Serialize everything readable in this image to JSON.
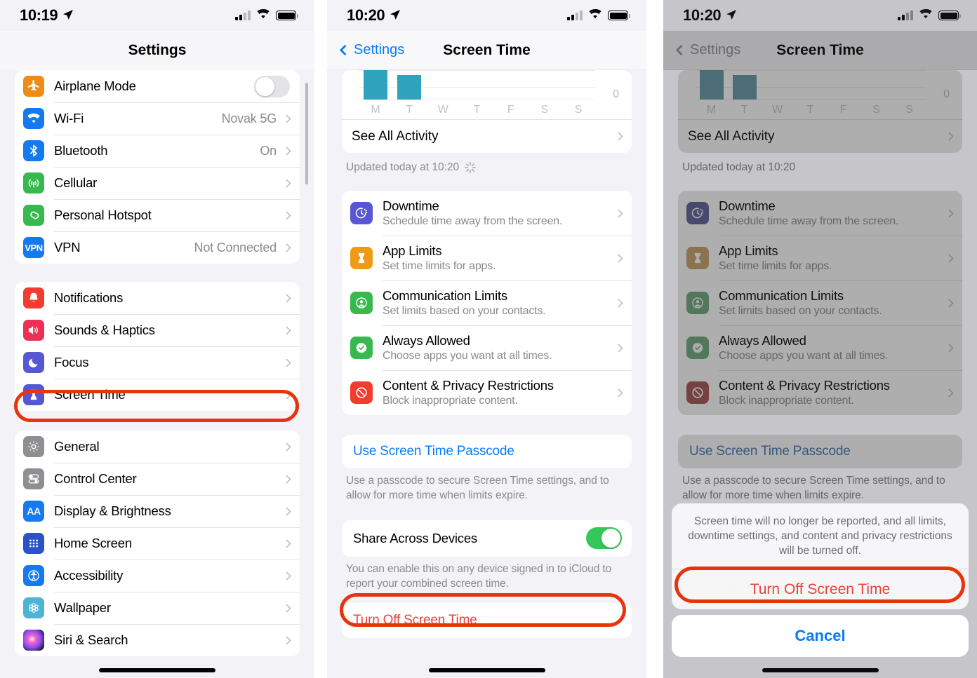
{
  "colors": {
    "annotation_red": "#e8340c",
    "ios_blue": "#067cfb",
    "destructive_red": "#e8443c",
    "toggle_green": "#34c759",
    "chart_bar_teal": "#2fa3bd",
    "group_bg": "#f2f2f7"
  },
  "panel1": {
    "status": {
      "time": "10:19",
      "location_icon": "location-arrow",
      "wifi_icon": "wifi",
      "battery_icon": "battery-full"
    },
    "nav_title": "Settings",
    "groups": [
      {
        "rows": [
          {
            "label": "Airplane Mode",
            "icon": "airplane-icon",
            "icon_color": "#ef8c14",
            "control": "toggle",
            "toggle_on": false
          },
          {
            "label": "Wi-Fi",
            "icon": "wifi-icon",
            "icon_color": "#1579ef",
            "value": "Novak 5G",
            "control": "chevron"
          },
          {
            "label": "Bluetooth",
            "icon": "bluetooth-icon",
            "icon_color": "#1579ef",
            "value": "On",
            "control": "chevron"
          },
          {
            "label": "Cellular",
            "icon": "cellular-icon",
            "icon_color": "#38b94e",
            "value": "",
            "control": "chevron"
          },
          {
            "label": "Personal Hotspot",
            "icon": "hotspot-icon",
            "icon_color": "#38b94e",
            "value": "",
            "control": "chevron"
          },
          {
            "label": "VPN",
            "icon": "vpn-icon",
            "icon_color": "#1579ef",
            "value": "Not Connected",
            "control": "chevron"
          }
        ]
      },
      {
        "rows": [
          {
            "label": "Notifications",
            "icon": "bell-icon",
            "icon_color": "#f33b30",
            "value": "",
            "control": "chevron"
          },
          {
            "label": "Sounds & Haptics",
            "icon": "speaker-icon",
            "icon_color": "#ee2f55",
            "value": "",
            "control": "chevron"
          },
          {
            "label": "Focus",
            "icon": "moon-icon",
            "icon_color": "#5757d6",
            "value": "",
            "control": "chevron"
          },
          {
            "label": "Screen Time",
            "icon": "hourglass-icon",
            "icon_color": "#5757d6",
            "value": "",
            "control": "chevron",
            "highlighted": true
          }
        ]
      },
      {
        "rows": [
          {
            "label": "General",
            "icon": "gear-icon",
            "icon_color": "#8e8e93",
            "value": "",
            "control": "chevron"
          },
          {
            "label": "Control Center",
            "icon": "control-center-icon",
            "icon_color": "#8e8e93",
            "value": "",
            "control": "chevron"
          },
          {
            "label": "Display & Brightness",
            "icon": "display-brightness-icon",
            "icon_color": "#1579ef",
            "value": "",
            "control": "chevron"
          },
          {
            "label": "Home Screen",
            "icon": "home-screen-icon",
            "icon_color": "#2b52c8",
            "value": "",
            "control": "chevron"
          },
          {
            "label": "Accessibility",
            "icon": "accessibility-icon",
            "icon_color": "#1579ef",
            "value": "",
            "control": "chevron"
          },
          {
            "label": "Wallpaper",
            "icon": "wallpaper-icon",
            "icon_color": "#4db5d4",
            "value": "",
            "control": "chevron"
          },
          {
            "label": "Siri & Search",
            "icon": "siri-icon",
            "icon_color": "#2a2a35",
            "value": "",
            "control": "chevron"
          }
        ]
      }
    ]
  },
  "panel2": {
    "status": {
      "time": "10:20"
    },
    "back_label": "Settings",
    "nav_title": "Screen Time",
    "see_all_activity": "See All Activity",
    "updated_text": "Updated today at 10:20",
    "has_spinner": true,
    "options": [
      {
        "title": "Downtime",
        "subtitle": "Schedule time away from the screen.",
        "icon": "downtime-icon",
        "icon_color": "#5757d6"
      },
      {
        "title": "App Limits",
        "subtitle": "Set time limits for apps.",
        "icon": "hourglass-icon",
        "icon_color": "#ef9a14"
      },
      {
        "title": "Communication Limits",
        "subtitle": "Set limits based on your contacts.",
        "icon": "person-circle-icon",
        "icon_color": "#38b94e"
      },
      {
        "title": "Always Allowed",
        "subtitle": "Choose apps you want at all times.",
        "icon": "check-badge-icon",
        "icon_color": "#38b94e"
      },
      {
        "title": "Content & Privacy Restrictions",
        "subtitle": "Block inappropriate content.",
        "icon": "no-entry-icon",
        "icon_color": "#f33b30"
      }
    ],
    "passcode_label": "Use Screen Time Passcode",
    "passcode_footnote": "Use a passcode to secure Screen Time settings, and to allow for more time when limits expire.",
    "share_label": "Share Across Devices",
    "share_toggle_on": true,
    "share_footnote": "You can enable this on any device signed in to iCloud to report your combined screen time.",
    "turn_off_label": "Turn Off Screen Time",
    "turn_off_highlighted": true
  },
  "panel3": {
    "status": {
      "time": "10:20"
    },
    "back_label": "Settings",
    "nav_title": "Screen Time",
    "see_all_activity": "See All Activity",
    "updated_text": "Updated today at 10:20",
    "has_spinner": false,
    "passcode_label": "Use Screen Time Passcode",
    "passcode_footnote": "Use a passcode to secure Screen Time settings, and to allow for more time when limits expire.",
    "action_sheet": {
      "message": "Screen time will no longer be reported, and all limits, downtime settings, and content and privacy restrictions will be turned off.",
      "destructive_label": "Turn Off Screen Time",
      "destructive_label_second": "Turn Off Screen Time",
      "cancel_label": "Cancel",
      "destructive_highlighted": true
    }
  },
  "chart_data": {
    "type": "bar",
    "title": "",
    "categories": [
      "M",
      "T",
      "W",
      "T",
      "F",
      "S",
      "S"
    ],
    "values": [
      100,
      82,
      0,
      0,
      0,
      0,
      0
    ],
    "ylim": [
      0,
      100
    ],
    "ytick_labels": [
      "0"
    ],
    "xlabel": "",
    "ylabel": "",
    "grid": true,
    "bar_color": "#2fa3bd",
    "note": "Weekly screen time bar chart, partially scrolled off top"
  }
}
